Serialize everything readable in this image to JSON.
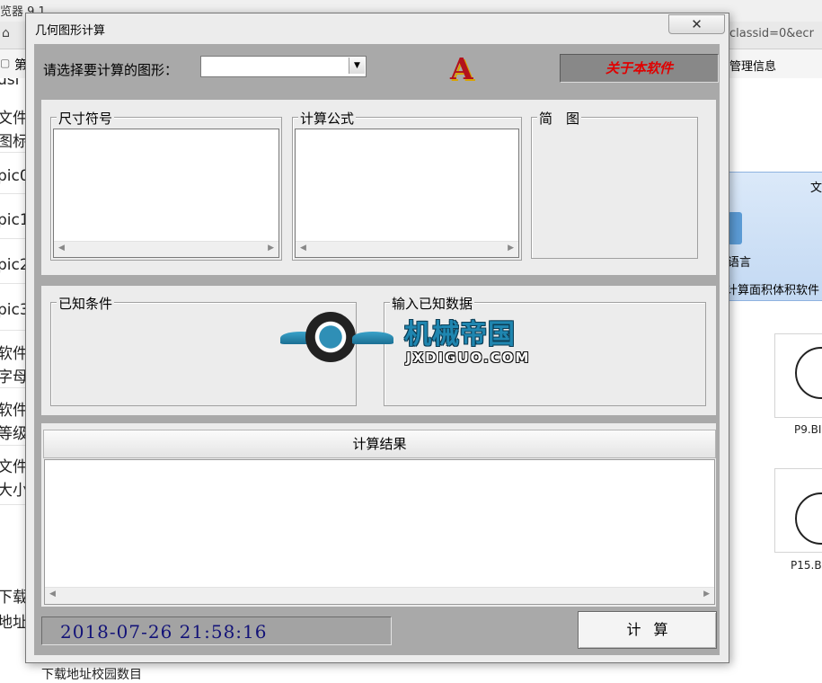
{
  "background": {
    "browser_title_fragment": "览器 9.1",
    "address_fragment": "classid=0&ecr",
    "bookmark_text": "第",
    "left_column": [
      "usi",
      "文件",
      "图标",
      "pic0",
      "pic1",
      "pic2",
      "pic3",
      "软件",
      "字母",
      "软件",
      "等级",
      "文件",
      "大小",
      "下载",
      "地址"
    ],
    "right_panel": {
      "header_fragment": "文",
      "management": "管理信息",
      "language": "语言",
      "software_label": "计算面积体积软件"
    },
    "thumbnails": [
      {
        "label": "P9.BI"
      },
      {
        "label": "P15.B"
      }
    ],
    "bottom_text_fragment": "下载地址校园数目"
  },
  "dialog": {
    "title": "几何图形计算",
    "close_symbol": "✕",
    "select_label": "请选择要计算的图形：",
    "select_value": "",
    "logo_letter": "A",
    "about_button": "关于本软件",
    "groups": {
      "dimension_symbols": "尺寸符号",
      "formula": "计算公式",
      "diagram": "简　图",
      "known_conditions": "已知条件",
      "input_known_data": "输入已知数据"
    },
    "result_header": "计算结果",
    "datetime": "2018-07-26 21:58:16",
    "calc_button": "计算",
    "scroll_left": "◀",
    "scroll_right": "▶",
    "dropdown_arrow": "▼"
  },
  "watermark": {
    "name": "机械帝国",
    "site": "JXDIGUO.COM"
  }
}
